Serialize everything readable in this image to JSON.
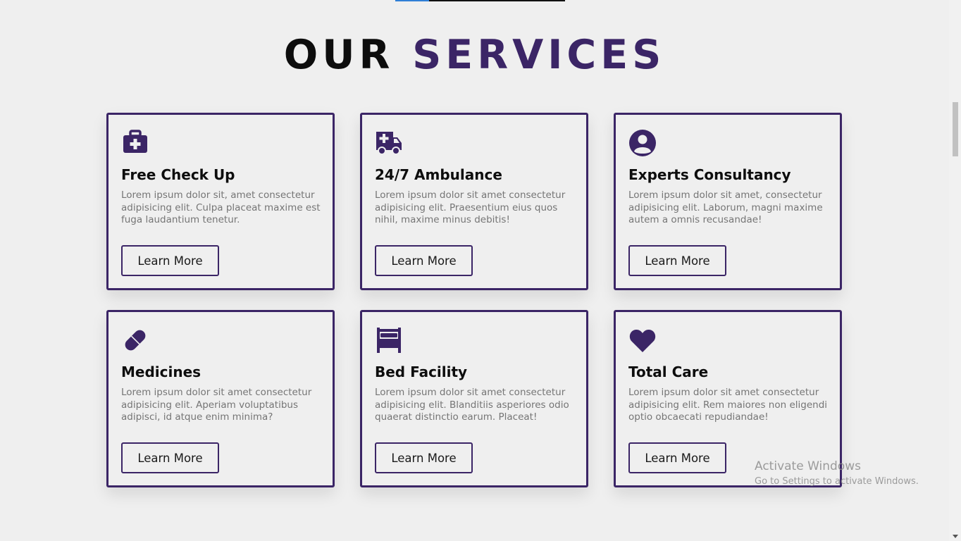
{
  "section": {
    "heading_part1": "OUR",
    "heading_part2": "SERVICES"
  },
  "services": [
    {
      "icon": "medkit-icon",
      "title": "Free Check Up",
      "text": "Lorem ipsum dolor sit, amet consectetur adipisicing elit. Culpa placeat maxime est fuga laudantium tenetur.",
      "button": "Learn More"
    },
    {
      "icon": "ambulance-icon",
      "title": "24/7 Ambulance",
      "text": "Lorem ipsum dolor sit amet consectetur adipisicing elit. Praesentium eius quos nihil, maxime minus debitis!",
      "button": "Learn More"
    },
    {
      "icon": "user-circle-icon",
      "title": "Experts Consultancy",
      "text": "Lorem ipsum dolor sit amet, consectetur adipisicing elit. Laborum, magni maxime autem a omnis recusandae!",
      "button": "Learn More"
    },
    {
      "icon": "pill-icon",
      "title": "Medicines",
      "text": "Lorem ipsum dolor sit amet consectetur adipisicing elit. Aperiam voluptatibus adipisci, id atque enim minima?",
      "button": "Learn More"
    },
    {
      "icon": "bed-icon",
      "title": "Bed Facility",
      "text": "Lorem ipsum dolor sit amet consectetur adipisicing elit. Blanditiis asperiores odio quaerat distinctio earum. Placeat!",
      "button": "Learn More"
    },
    {
      "icon": "heart-icon",
      "title": "Total Care",
      "text": "Lorem ipsum dolor sit amet consectetur adipisicing elit. Rem maiores non eligendi optio obcaecati repudiandae!",
      "button": "Learn More"
    }
  ],
  "colors": {
    "accent": "#3b2566",
    "background": "#efefef",
    "text_dark": "#0d0d0d",
    "text_muted": "#757575"
  },
  "watermark": {
    "line1": "Activate Windows",
    "line2": "Go to Settings to activate Windows."
  }
}
